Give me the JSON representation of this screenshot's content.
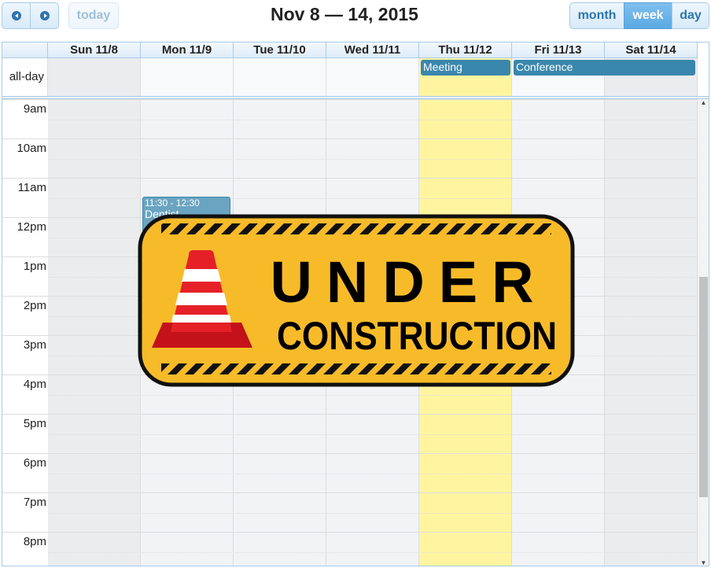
{
  "toolbar": {
    "prev": "prev",
    "next": "next",
    "today": "today",
    "title": "Nov 8 — 14, 2015",
    "views": [
      "month",
      "week",
      "day"
    ],
    "active_view": "week"
  },
  "days": [
    "Sun 11/8",
    "Mon 11/9",
    "Tue 11/10",
    "Wed 11/11",
    "Thu 11/12",
    "Fri 11/13",
    "Sat 11/14"
  ],
  "allday_label": "all-day",
  "hours": [
    "9am",
    "10am",
    "11am",
    "12pm",
    "1pm",
    "2pm",
    "3pm",
    "4pm",
    "5pm",
    "6pm",
    "7pm",
    "8pm"
  ],
  "allday_events": [
    {
      "title": "Meeting"
    },
    {
      "title": "Conference"
    }
  ],
  "events": [
    {
      "time": "11:30 - 12:30",
      "title": "Dentist"
    }
  ],
  "overlay": {
    "line1": "UNDER",
    "line2": "CONSTRUCTION"
  }
}
